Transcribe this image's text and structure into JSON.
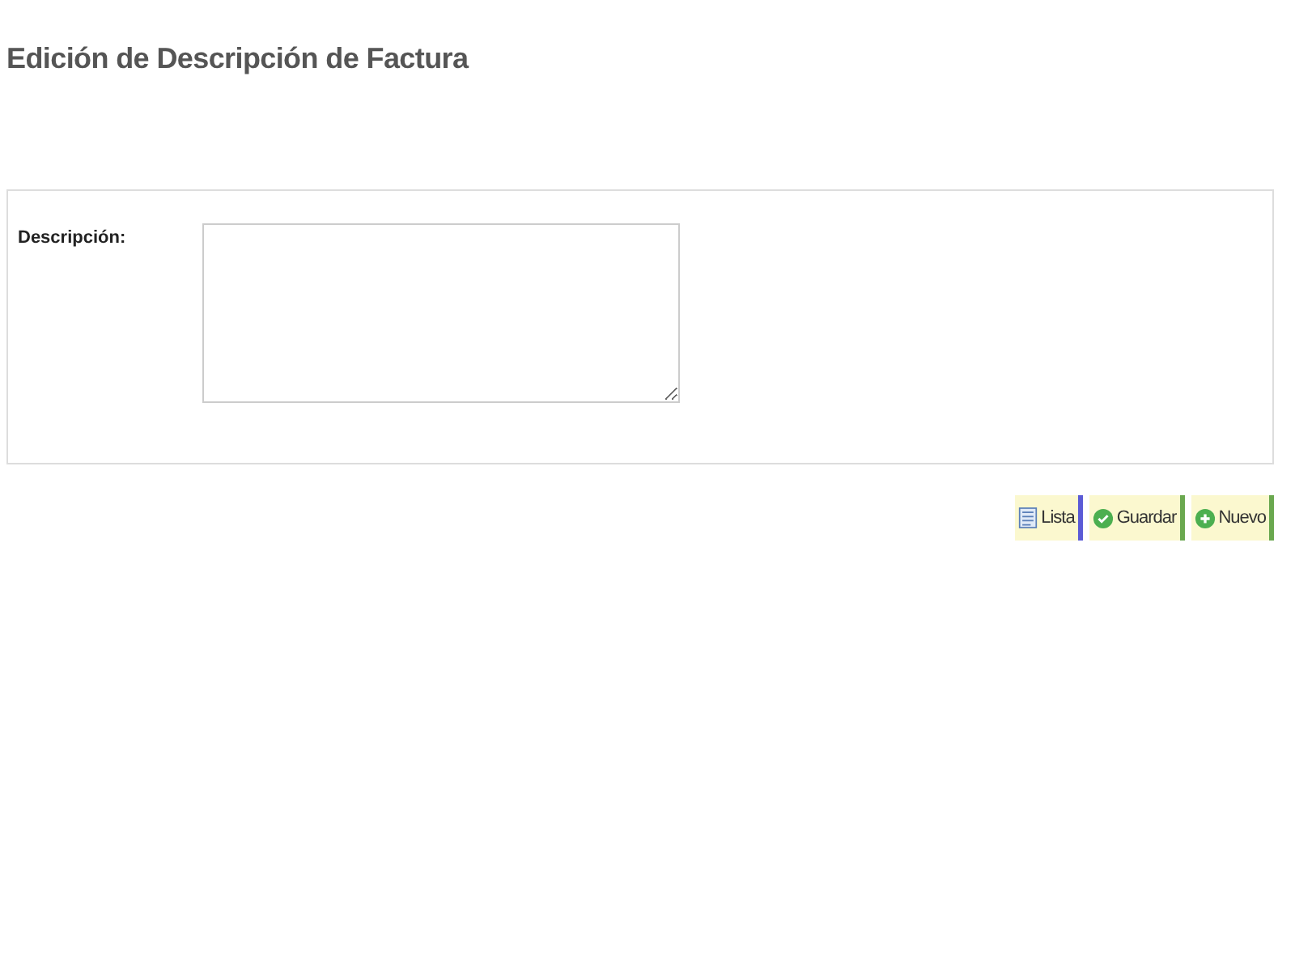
{
  "title": "Edición de Descripción de Factura",
  "form": {
    "fields": [
      {
        "label": "Descripción:"
      }
    ]
  },
  "buttons": [
    {
      "label": "Lista",
      "kind": "list",
      "color": "#5b5bd6"
    },
    {
      "label": "Guardar",
      "kind": "save",
      "color": "#6aa84f"
    },
    {
      "label": "Nuevo",
      "kind": "new",
      "color": "#6aa84f"
    }
  ]
}
